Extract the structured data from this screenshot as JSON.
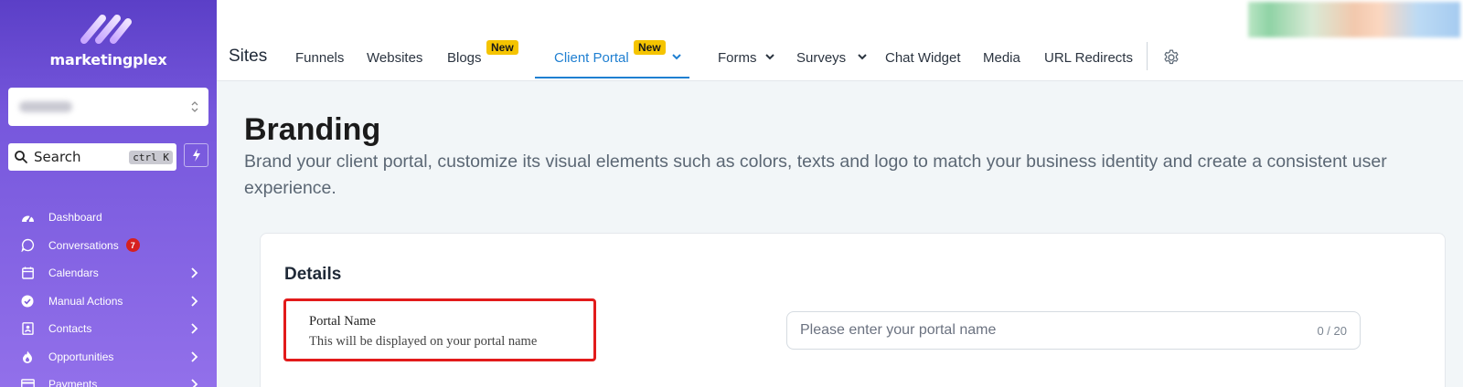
{
  "sidebar": {
    "brand": "marketingplex",
    "search": {
      "label": "Search",
      "shortcut": "ctrl K"
    },
    "items": [
      {
        "label": "Dashboard",
        "icon": "dashboard-icon"
      },
      {
        "label": "Conversations",
        "icon": "chat-icon",
        "badge": "7"
      },
      {
        "label": "Calendars",
        "icon": "calendar-icon"
      },
      {
        "label": "Manual Actions",
        "icon": "check-circle-icon"
      },
      {
        "label": "Contacts",
        "icon": "contacts-icon"
      },
      {
        "label": "Opportunities",
        "icon": "funnel-icon"
      },
      {
        "label": "Payments",
        "icon": "card-icon"
      }
    ]
  },
  "header": {
    "title": "Sites",
    "tabs": [
      {
        "label": "Funnels"
      },
      {
        "label": "Websites"
      },
      {
        "label": "Blogs",
        "badge": "New"
      },
      {
        "label": "Client Portal",
        "badge": "New",
        "active": true
      },
      {
        "label": "Forms"
      },
      {
        "label": "Surveys"
      },
      {
        "label": "Chat Widget"
      },
      {
        "label": "Media"
      },
      {
        "label": "URL Redirects"
      }
    ]
  },
  "main": {
    "title": "Branding",
    "description": "Brand your client portal, customize its visual elements such as colors, texts and logo to match your business identity and create a consistent user experience.",
    "card": {
      "title": "Details",
      "field": {
        "label": "Portal Name",
        "help": "This will be displayed on your portal name",
        "placeholder": "Please enter your portal name",
        "counter": "0 / 20"
      }
    }
  },
  "colors": {
    "accent": "#1f7fd1",
    "badge": "#f5c400",
    "highlight": "#e21b1b",
    "sidebar_top": "#5b3fc7",
    "sidebar_bottom": "#9270ea"
  }
}
